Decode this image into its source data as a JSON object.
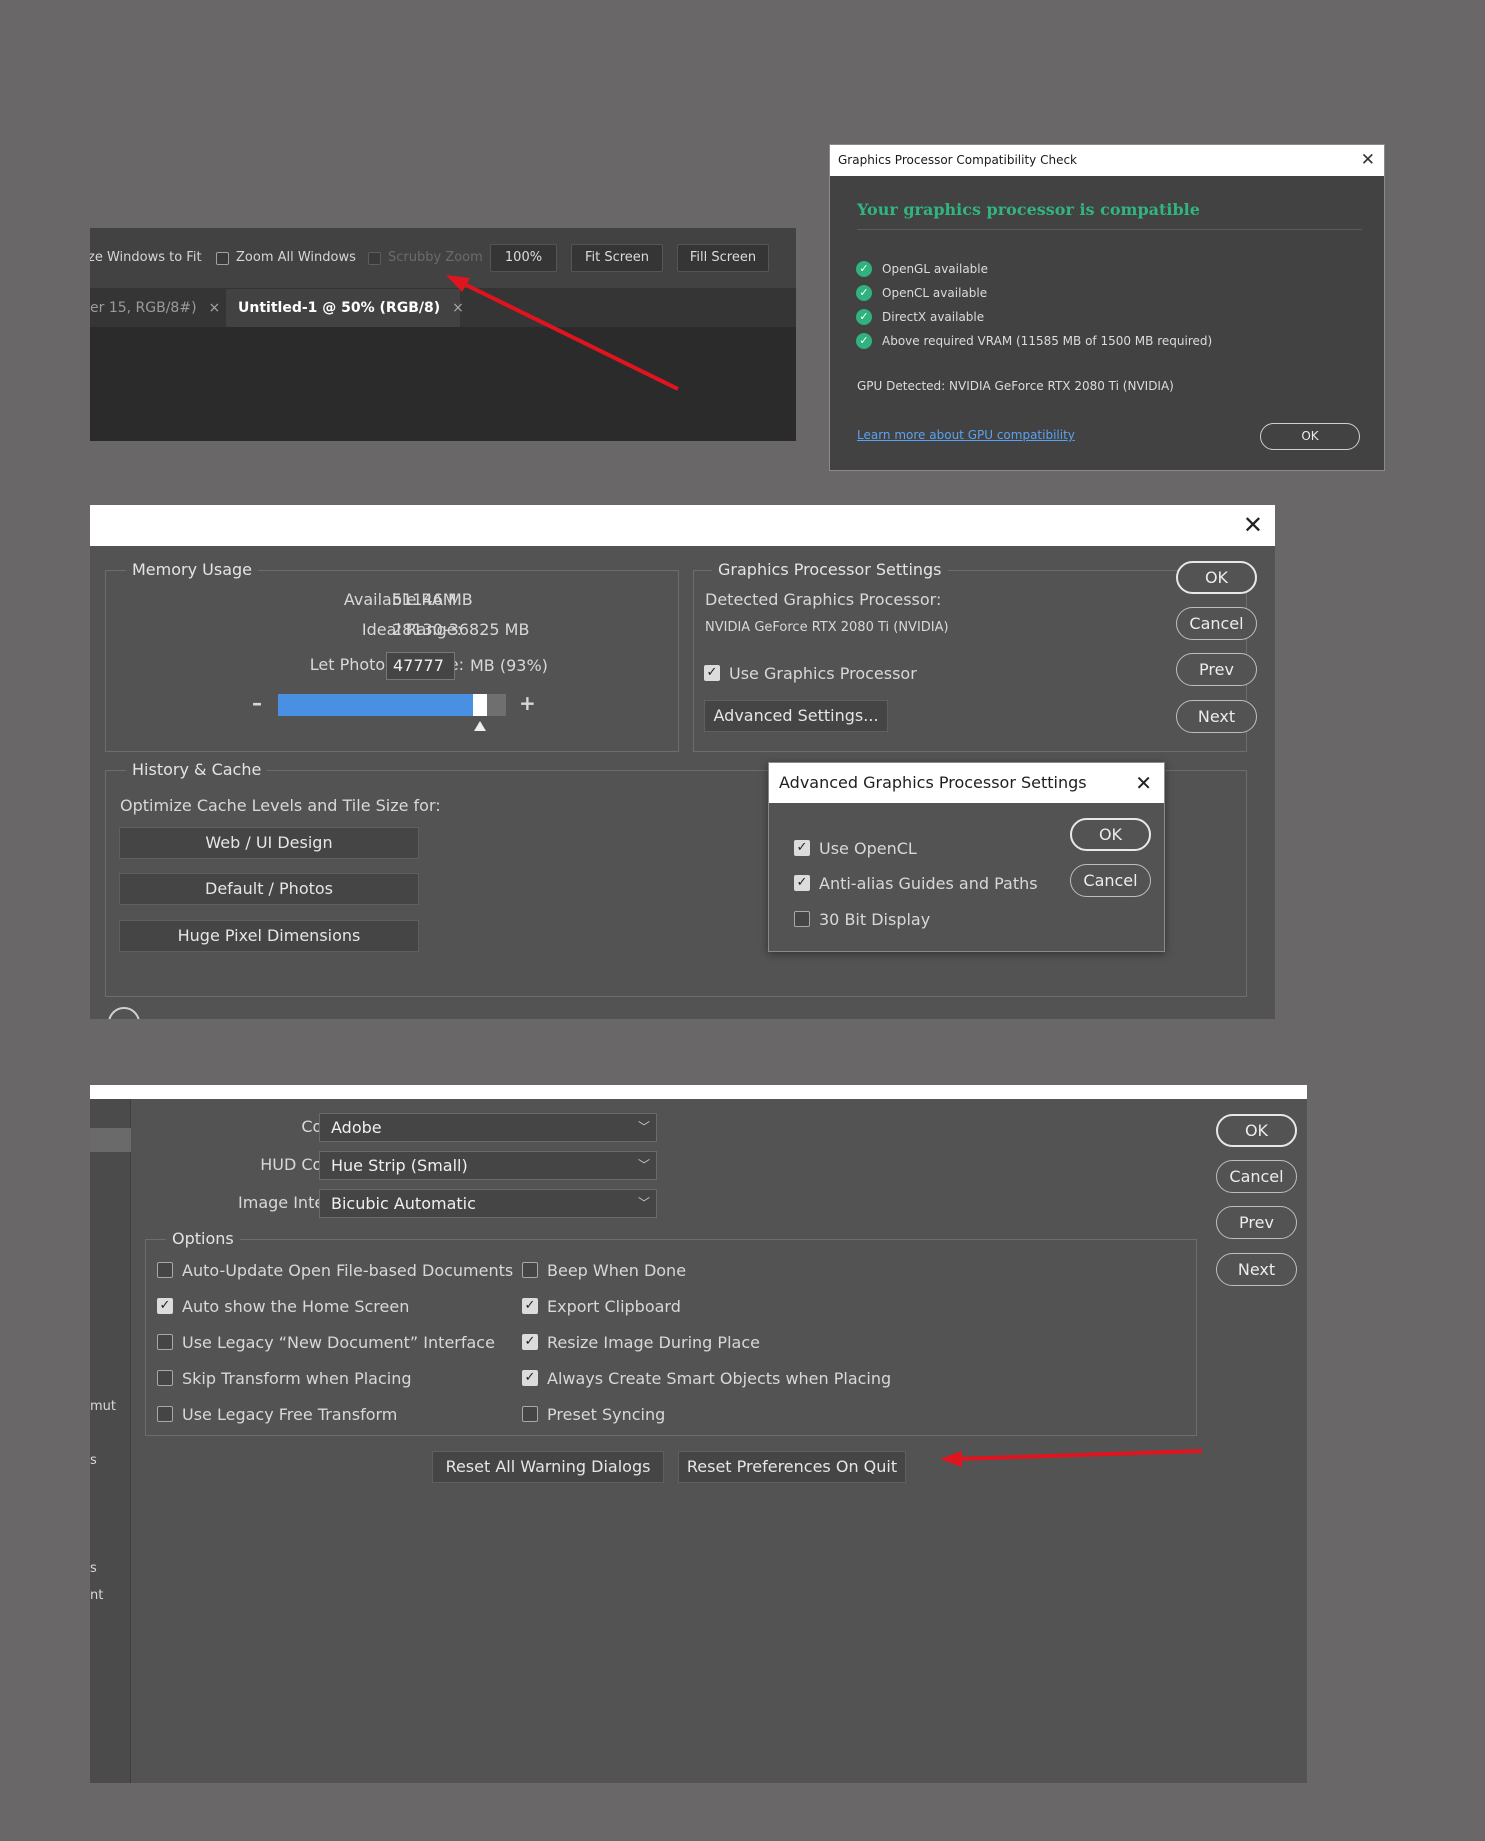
{
  "options_bar": {
    "resize_windows_label": "ze Windows to Fit",
    "zoom_all_label": "Zoom All Windows",
    "scrubby_zoom_label": "Scrubby Zoom",
    "zoom_percent": "100%",
    "fit_screen": "Fit Screen",
    "fill_screen": "Fill Screen",
    "tabs": [
      {
        "label": "er 15, RGB/8#)",
        "close": "×"
      },
      {
        "label": "Untitled-1 @ 50% (RGB/8)",
        "close": "×"
      }
    ]
  },
  "gpu_check": {
    "title": "Graphics Processor Compatibility Check",
    "close": "✕",
    "headline": "Your graphics processor is compatible",
    "checks": [
      "OpenGL available",
      "OpenCL available",
      "DirectX available",
      "Above required VRAM (11585 MB of 1500 MB required)"
    ],
    "gpu_detected": "GPU Detected: NVIDIA GeForce RTX 2080 Ti (NVIDIA)",
    "learn_more": "Learn more about GPU compatibility",
    "ok": "OK"
  },
  "performance": {
    "close": "✕",
    "memory": {
      "title": "Memory Usage",
      "available_ram_label": "Available RAM:",
      "available_ram_value": "51146 MB",
      "ideal_range_label": "Ideal Range:",
      "ideal_range_value": "28130-36825 MB",
      "let_use_label": "Let Photoshop Use:",
      "let_use_value": "47777",
      "let_use_suffix": "MB (93%)",
      "minus": "–",
      "plus": "+",
      "slider_percent": 0.93
    },
    "gpu_settings": {
      "title": "Graphics Processor Settings",
      "detected_label": "Detected Graphics Processor:",
      "detected_value": "NVIDIA GeForce RTX 2080 Ti (NVIDIA)",
      "use_gpu_label": "Use Graphics Processor",
      "advanced_button": "Advanced Settings..."
    },
    "history": {
      "title": "History & Cache",
      "optimize_label": "Optimize Cache Levels and Tile Size for:",
      "buttons": [
        "Web / UI Design",
        "Default / Photos",
        "Huge Pixel Dimensions"
      ]
    },
    "buttons": {
      "ok": "OK",
      "cancel": "Cancel",
      "prev": "Prev",
      "next": "Next"
    },
    "advanced_dialog": {
      "title": "Advanced Graphics Processor Settings",
      "close": "✕",
      "options": [
        {
          "label": "Use OpenCL",
          "checked": true
        },
        {
          "label": "Anti-alias Guides and Paths",
          "checked": true
        },
        {
          "label": "30 Bit Display",
          "checked": false
        }
      ],
      "ok": "OK",
      "cancel": "Cancel"
    }
  },
  "general": {
    "sidebar_fragments": [
      "mut",
      "s",
      "s",
      "nt"
    ],
    "color_picker_label": "Color Picker:",
    "color_picker_value": "Adobe",
    "hud_label": "HUD Color Picker:",
    "hud_value": "Hue Strip (Small)",
    "interp_label": "Image Interpolation:",
    "interp_value": "Bicubic Automatic",
    "options_title": "Options",
    "options_left": [
      {
        "label": "Auto-Update Open File-based Documents",
        "checked": false
      },
      {
        "label": "Auto show the Home Screen",
        "checked": true
      },
      {
        "label": "Use Legacy “New Document” Interface",
        "checked": false
      },
      {
        "label": "Skip Transform when Placing",
        "checked": false
      },
      {
        "label": "Use Legacy Free Transform",
        "checked": false
      }
    ],
    "options_right": [
      {
        "label": "Beep When Done",
        "checked": false
      },
      {
        "label": "Export Clipboard",
        "checked": true
      },
      {
        "label": "Resize Image During Place",
        "checked": true
      },
      {
        "label": "Always Create Smart Objects when Placing",
        "checked": true
      },
      {
        "label": "Preset Syncing",
        "checked": false
      }
    ],
    "reset_warnings": "Reset All Warning Dialogs",
    "reset_prefs": "Reset Preferences On Quit",
    "buttons": {
      "ok": "OK",
      "cancel": "Cancel",
      "prev": "Prev",
      "next": "Next"
    }
  },
  "colors": {
    "annotation_arrow": "#e0141e",
    "compatible_green": "#31b57f",
    "slider_blue": "#4a90e2"
  }
}
